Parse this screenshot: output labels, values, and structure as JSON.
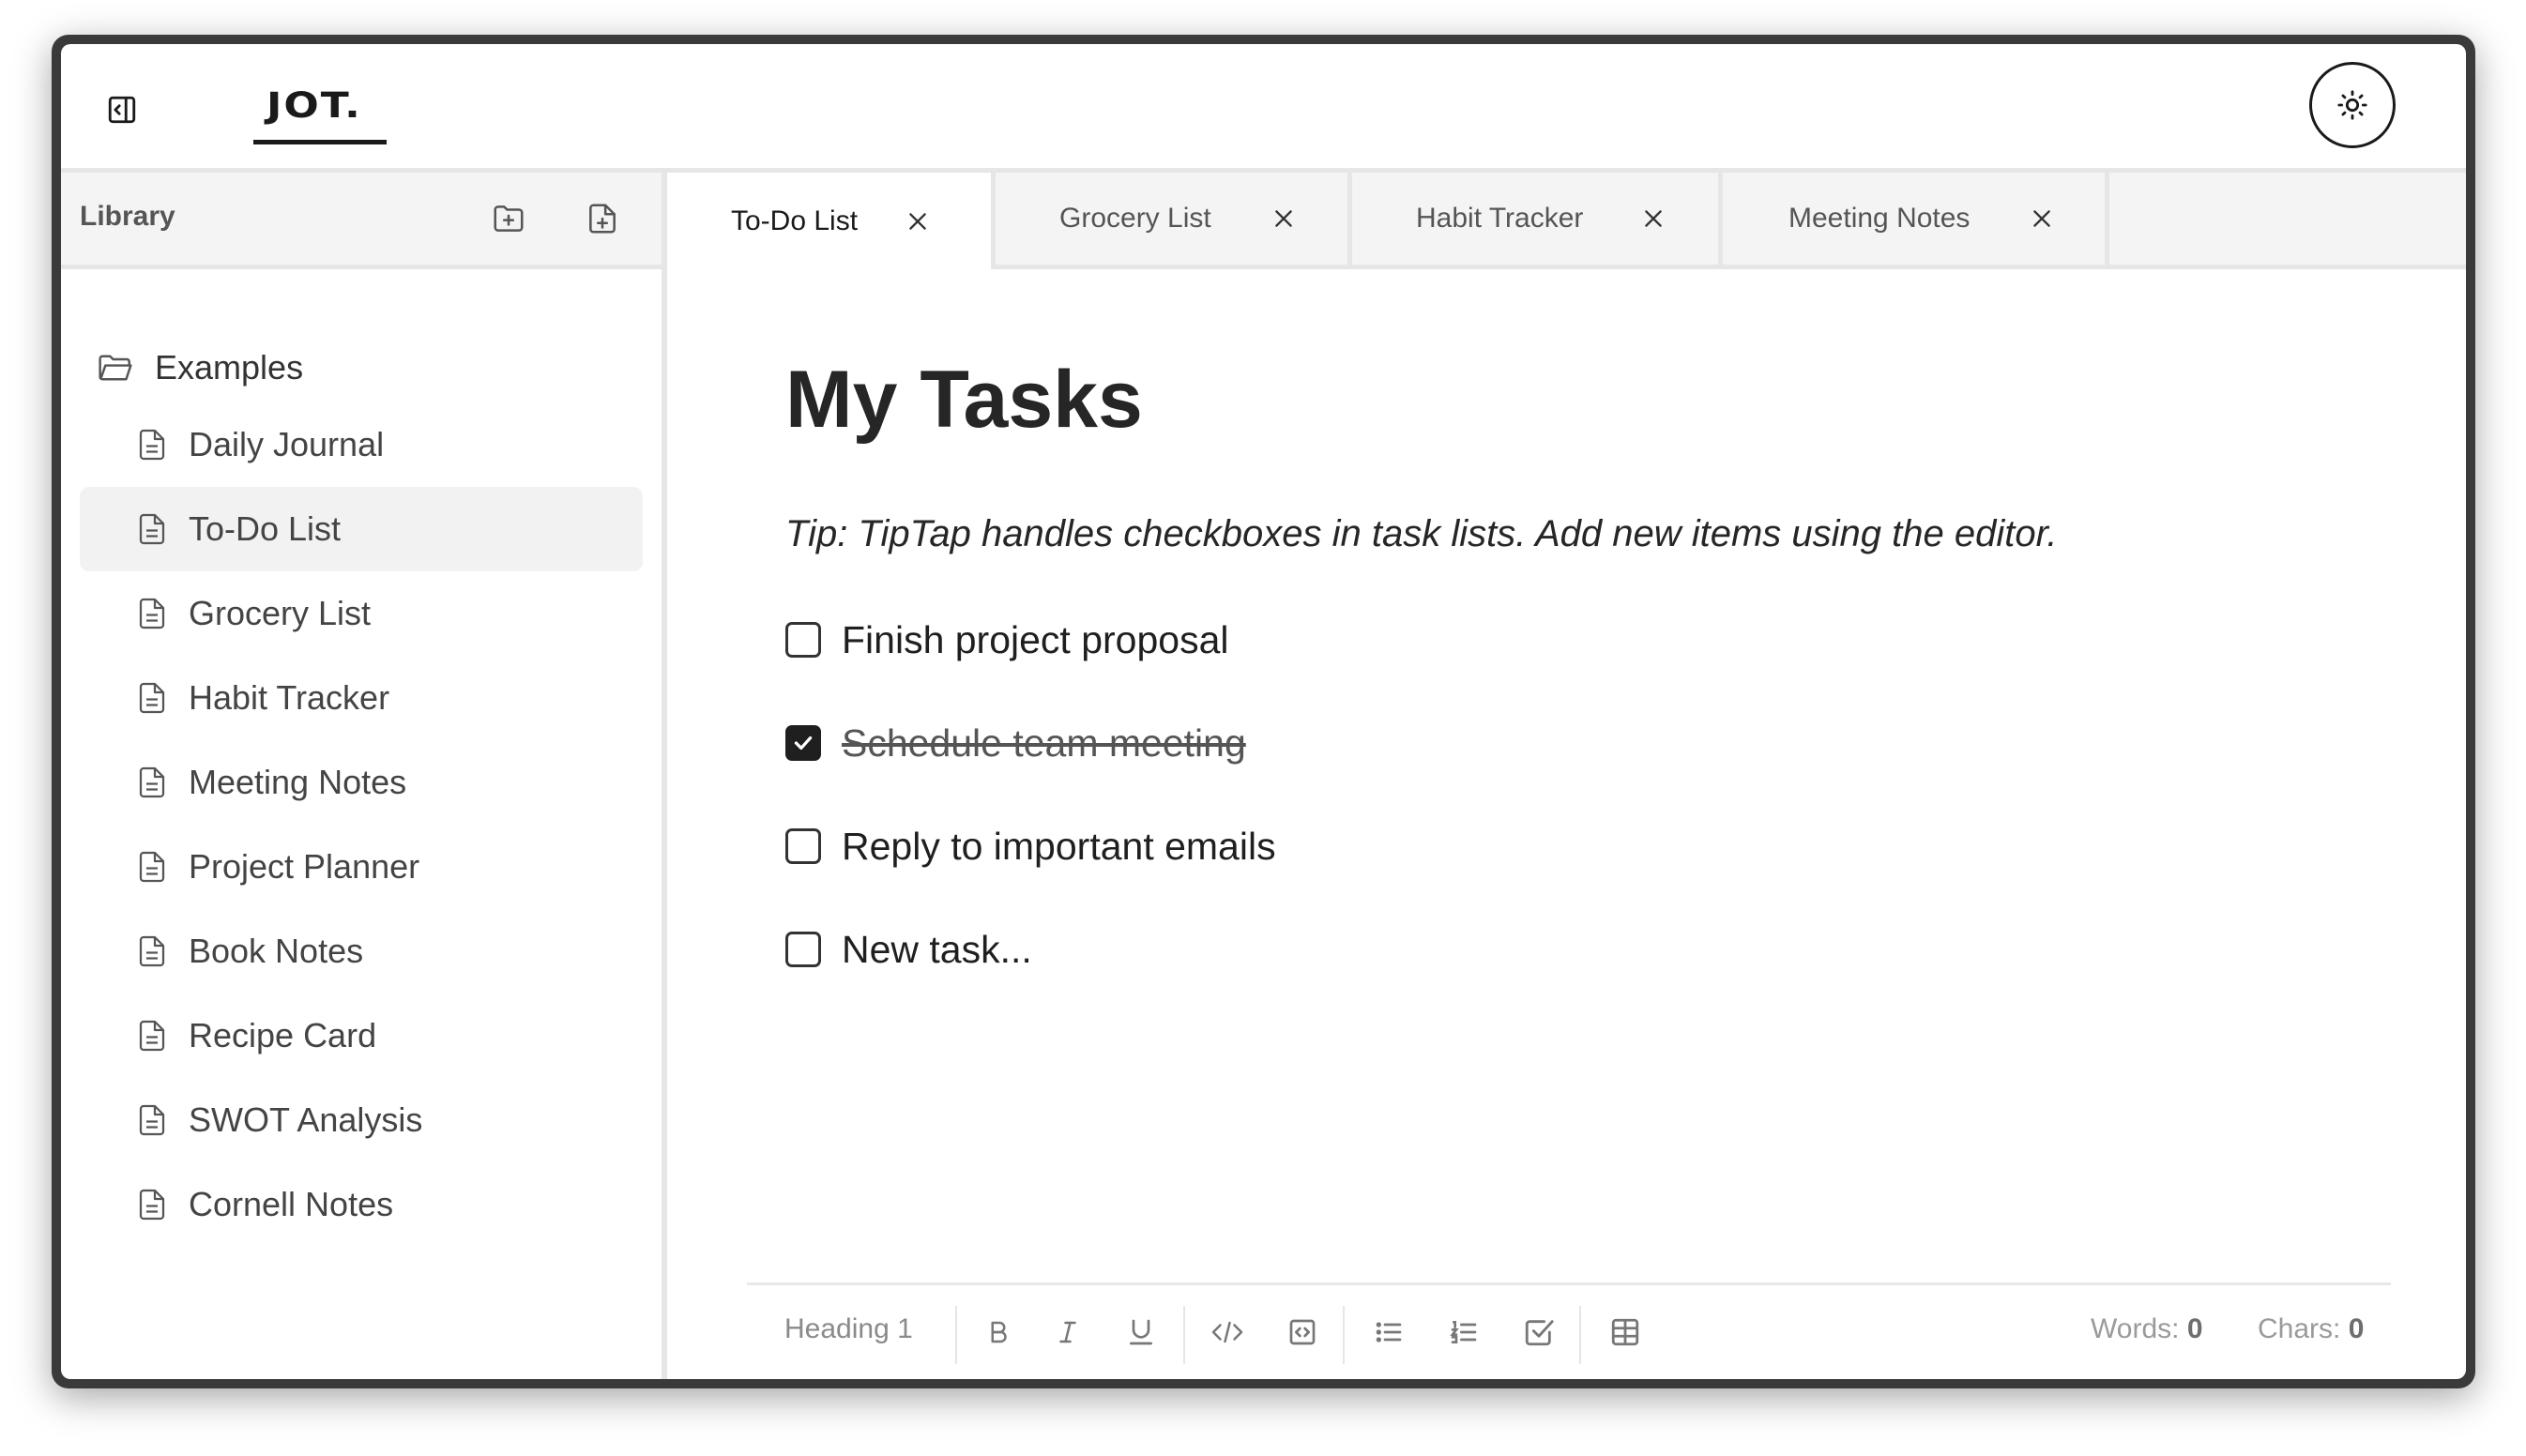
{
  "header": {
    "logo": "JOT.",
    "toggle_sidebar_icon": "sidebar-collapse-icon",
    "theme_icon": "sun-icon"
  },
  "sidebar": {
    "title": "Library",
    "new_folder_icon": "folder-plus-icon",
    "new_file_icon": "file-plus-icon",
    "folder": {
      "name": "Examples",
      "icon": "folder-open-icon"
    },
    "items": [
      {
        "label": "Daily Journal"
      },
      {
        "label": "To-Do List",
        "active": true
      },
      {
        "label": "Grocery List"
      },
      {
        "label": "Habit Tracker"
      },
      {
        "label": "Meeting Notes"
      },
      {
        "label": "Project Planner"
      },
      {
        "label": "Book Notes"
      },
      {
        "label": "Recipe Card"
      },
      {
        "label": "SWOT Analysis"
      },
      {
        "label": "Cornell Notes"
      }
    ]
  },
  "tabs": [
    {
      "label": "To-Do List",
      "active": true
    },
    {
      "label": "Grocery List"
    },
    {
      "label": "Habit Tracker"
    },
    {
      "label": "Meeting Notes"
    }
  ],
  "document": {
    "title": "My Tasks",
    "tip": "Tip: TipTap handles checkboxes in task lists. Add new items using the editor.",
    "tasks": [
      {
        "text": "Finish project proposal",
        "checked": false
      },
      {
        "text": "Schedule team meeting",
        "checked": true
      },
      {
        "text": "Reply to important emails",
        "checked": false
      },
      {
        "text": "New task...",
        "checked": false
      }
    ]
  },
  "toolbar": {
    "heading_label": "Heading 1",
    "words_label": "Words:",
    "words_value": "0",
    "chars_label": "Chars:",
    "chars_value": "0"
  },
  "colors": {
    "text": "#1f1f1f",
    "muted": "#8a8a8a",
    "border": "#e6e6e6",
    "active_bg": "#f2f2f2"
  }
}
